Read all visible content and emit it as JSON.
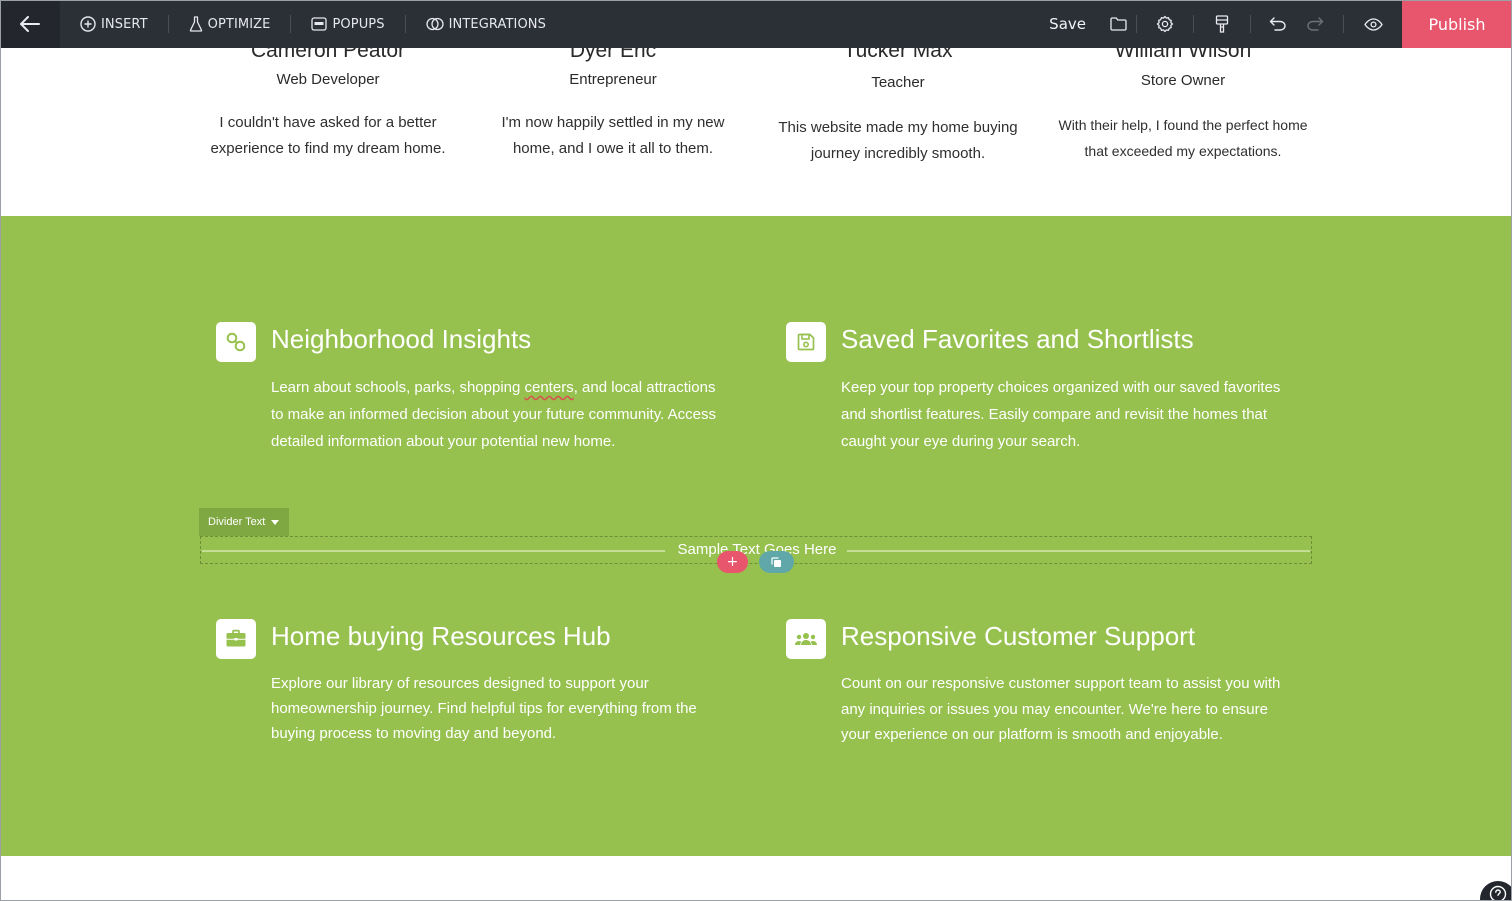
{
  "toolbar": {
    "insert_label": "INSERT",
    "optimize_label": "OPTIMIZE",
    "popups_label": "POPUPS",
    "integrations_label": "INTEGRATIONS",
    "save_label": "Save",
    "publish_label": "Publish",
    "icons": [
      "back-arrow-icon",
      "folder-icon",
      "gear-icon",
      "paint-brush-icon",
      "undo-icon",
      "redo-icon",
      "eye-icon"
    ]
  },
  "testimonials": [
    {
      "name": "Cameron Peator",
      "role": "Web Developer",
      "quote": "I couldn't have asked for a better experience to find my dream home."
    },
    {
      "name": "Dyer Eric",
      "role": "Entrepreneur",
      "quote": "I'm now happily settled in my new home, and I owe it all to them."
    },
    {
      "name": "Tucker Max",
      "role": "Teacher",
      "quote": "This website made my home buying journey incredibly smooth."
    },
    {
      "name": "William Wilson",
      "role": "Store Owner",
      "quote": "With their help, I found the perfect home that exceeded my expectations."
    }
  ],
  "features": [
    {
      "title": "Neighborhood Insights",
      "desc_before": "Learn about schools, parks, shopping ",
      "desc_flagged": "centers",
      "desc_after": ", and local attractions to make an informed decision about your future community. Access detailed information about your potential new home.",
      "icon": "link-icon"
    },
    {
      "title": "Saved Favorites and Shortlists",
      "desc": "Keep your top property choices organized with our saved favorites and shortlist features. Easily compare and revisit the homes that caught your eye during your search.",
      "icon": "floppy-disk-icon"
    },
    {
      "title": "Home buying Resources Hub",
      "desc": "Explore our library of resources designed to support your homeownership journey. Find helpful tips for everything from the buying process to moving day and beyond.",
      "icon": "briefcase-icon"
    },
    {
      "title": "Responsive Customer Support",
      "desc": "Count on our responsive customer support team to assist you with any inquiries or issues you may encounter. We're here to ensure your experience on our platform is smooth and enjoyable.",
      "icon": "users-icon"
    }
  ],
  "divider": {
    "tag_label": "Divider Text",
    "text": "Sample Text Goes Here",
    "add_symbol": "+"
  },
  "colors": {
    "toolbar_bg": "#2b2f36",
    "publish": "#e8566e",
    "section_green": "#96c14f",
    "copy_chip": "#5fa7a8"
  }
}
